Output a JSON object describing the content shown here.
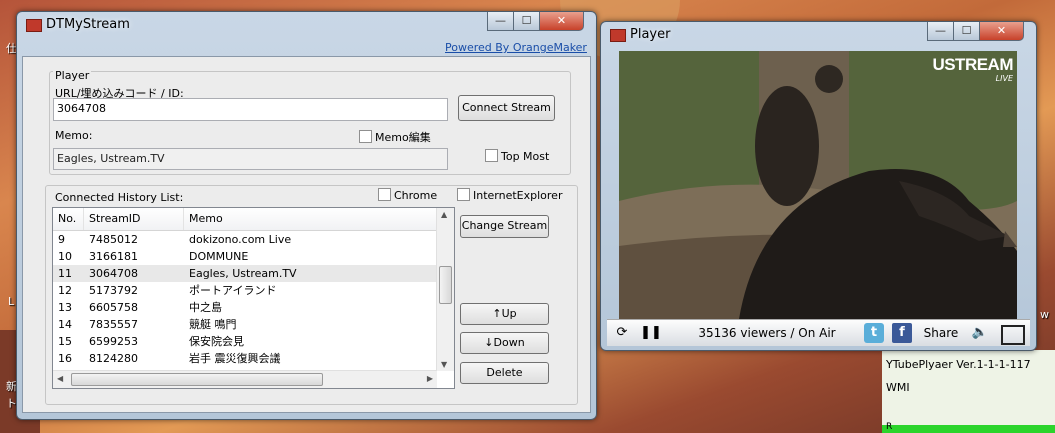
{
  "desktop": {
    "left_char_top": "仕",
    "left_char_mid": "L",
    "left_char_bottom1": "新",
    "left_char_bottom2": "ト",
    "right_char": "w",
    "ytube_label": "YTubePlyaer Ver.1-1-1-117",
    "wmi_label": "WMI",
    "bottom_char": "R"
  },
  "main_window": {
    "title": "DTMyStream",
    "powered_link": "Powered By OrangeMaker",
    "minimize": "—",
    "maximize": "☐",
    "close": "✕",
    "player_group": {
      "label": "Player",
      "url_label": "URL/埋め込みコード / ID:",
      "url_value": "3064708",
      "connect_button": "Connect Stream",
      "memo_label": "Memo:",
      "memo_edit_checkbox": "Memo編集",
      "memo_value": "Eagles, Ustream.TV",
      "top_most_checkbox": "Top Most"
    },
    "history_group": {
      "label": "Connected History List:",
      "chrome_checkbox": "Chrome",
      "ie_checkbox": "InternetExplorer",
      "columns": [
        "No.",
        "StreamID",
        "Memo"
      ],
      "rows": [
        {
          "no": "9",
          "id": "7485012",
          "memo": "dokizono.com Live"
        },
        {
          "no": "10",
          "id": "3166181",
          "memo": "DOMMUNE"
        },
        {
          "no": "11",
          "id": "3064708",
          "memo": "Eagles, Ustream.TV"
        },
        {
          "no": "12",
          "id": "5173792",
          "memo": "ポートアイランド"
        },
        {
          "no": "13",
          "id": "6605758",
          "memo": "中之島"
        },
        {
          "no": "14",
          "id": "7835557",
          "memo": "競艇 鳴門"
        },
        {
          "no": "15",
          "id": "6599253",
          "memo": "保安院会見"
        },
        {
          "no": "16",
          "id": "8124280",
          "memo": "岩手 震災復興会議"
        }
      ],
      "change_button": "Change Stream",
      "up_button": "↑Up",
      "down_button": "↓Down",
      "delete_button": "Delete"
    }
  },
  "player_window": {
    "title": "Player",
    "minimize": "—",
    "maximize": "☐",
    "close": "✕",
    "brand_logo": "USTREAM",
    "brand_sub": "LIVE",
    "viewers_text": "35136 viewers / On Air",
    "share_label": "Share",
    "twitter_icon_label": "t",
    "facebook_icon_label": "f"
  }
}
